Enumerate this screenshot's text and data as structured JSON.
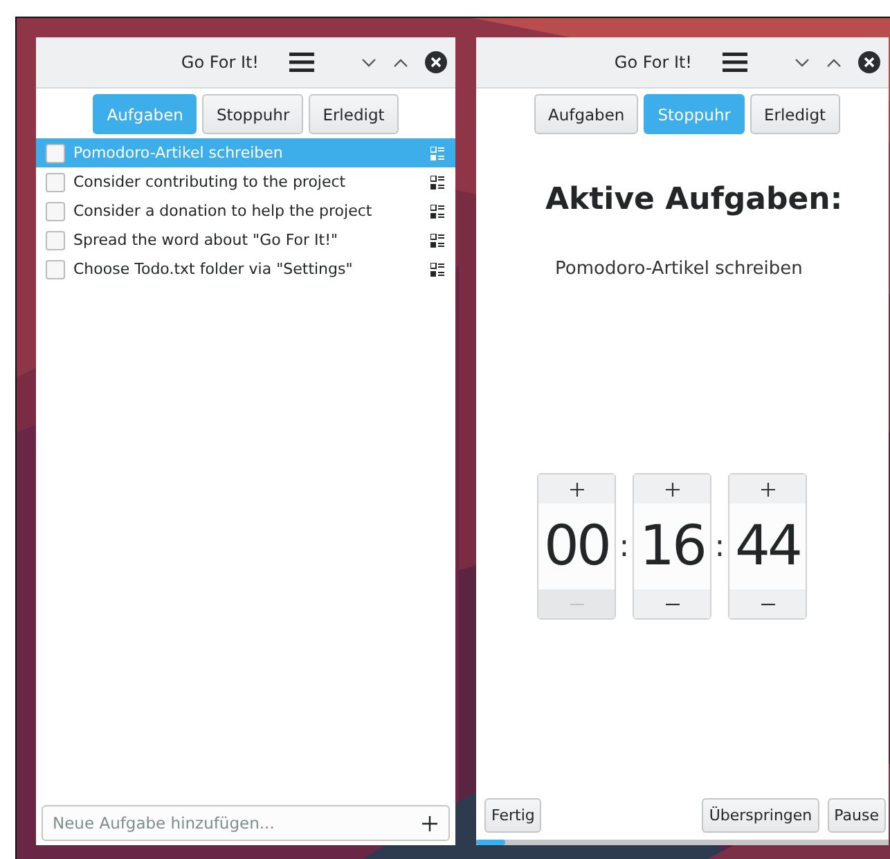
{
  "windows": [
    {
      "title": "Go For It!",
      "tabs": [
        {
          "label": "Aufgaben",
          "selected": true
        },
        {
          "label": "Stoppuhr",
          "selected": false
        },
        {
          "label": "Erledigt",
          "selected": false
        }
      ],
      "tasks": [
        {
          "text": "Pomodoro-Artikel schreiben",
          "checked": false,
          "selected": true
        },
        {
          "text": "Consider contributing to the project",
          "checked": false,
          "selected": false
        },
        {
          "text": "Consider a donation to help the project",
          "checked": false,
          "selected": false
        },
        {
          "text": "Spread the word about \"Go For It!\"",
          "checked": false,
          "selected": false
        },
        {
          "text": "Choose Todo.txt folder via \"Settings\"",
          "checked": false,
          "selected": false
        }
      ],
      "new_task": {
        "placeholder": "Neue Aufgabe hinzufügen..."
      }
    },
    {
      "title": "Go For It!",
      "tabs": [
        {
          "label": "Aufgaben",
          "selected": false
        },
        {
          "label": "Stoppuhr",
          "selected": true
        },
        {
          "label": "Erledigt",
          "selected": false
        }
      ],
      "heading": "Aktive Aufgaben:",
      "active_task": "Pomodoro-Artikel schreiben",
      "timer": [
        {
          "value": "00",
          "minus_disabled": true
        },
        {
          "value": "16",
          "minus_disabled": false
        },
        {
          "value": "44",
          "minus_disabled": false
        }
      ],
      "separators": [
        ":",
        ":"
      ],
      "buttons": [
        "Fertig",
        "Überspringen",
        "Pause"
      ],
      "progress": {
        "level": 0.07
      }
    }
  ]
}
